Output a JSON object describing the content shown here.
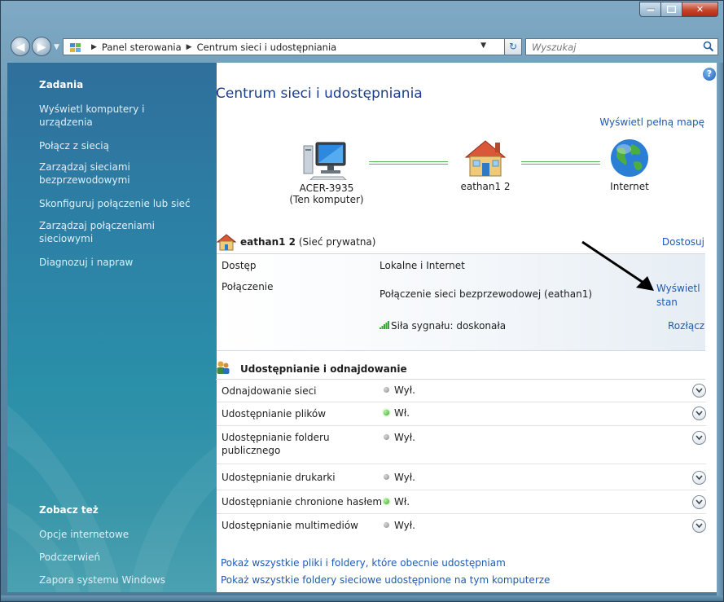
{
  "address": {
    "crumbs": [
      "Panel sterowania",
      "Centrum sieci i udostępniania"
    ],
    "search_placeholder": "Wyszukaj"
  },
  "sidebar": {
    "tasks_header": "Zadania",
    "tasks": [
      "Wyświetl komputery i urządzenia",
      "Połącz z siecią",
      "Zarządzaj sieciami bezprzewodowymi",
      "Skonfiguruj połączenie lub sieć",
      "Zarządzaj połączeniami sieciowymi",
      "Diagnozuj i napraw"
    ],
    "see_also_header": "Zobacz też",
    "see_also": [
      "Opcje internetowe",
      "Podczerwień",
      "Zapora systemu Windows"
    ]
  },
  "main": {
    "title": "Centrum sieci i udostępniania",
    "full_map_link": "Wyświetl pełną mapę",
    "nodes": [
      {
        "line1": "ACER-3935",
        "line2": "(Ten komputer)"
      },
      {
        "line1": "eathan1  2",
        "line2": ""
      },
      {
        "line1": "Internet",
        "line2": ""
      }
    ],
    "network": {
      "name": "eathan1  2",
      "type": "(Sieć prywatna)",
      "customize": "Dostosuj",
      "access_label": "Dostęp",
      "access_value": "Lokalne i Internet",
      "connection_label": "Połączenie",
      "connection_value": "Połączenie sieci bezprzewodowej (eathan1)",
      "view_status": "Wyświetl stan",
      "signal": "Siła sygnału: doskonała",
      "disconnect": "Rozłącz"
    },
    "sharing": {
      "header": "Udostępnianie i odnajdowanie",
      "rows": [
        {
          "label": "Odnajdowanie sieci",
          "status": "Wył.",
          "on": false
        },
        {
          "label": "Udostępnianie plików",
          "status": "Wł.",
          "on": true
        },
        {
          "label": "Udostępnianie folderu publicznego",
          "status": "Wył.",
          "on": false
        },
        {
          "label": "Udostępnianie drukarki",
          "status": "Wył.",
          "on": false
        },
        {
          "label": "Udostępnianie chronione hasłem",
          "status": "Wł.",
          "on": true
        },
        {
          "label": "Udostępnianie multimediów",
          "status": "Wył.",
          "on": false
        }
      ]
    },
    "bottom_links": [
      "Pokaż wszystkie pliki i foldery, które obecnie udostępniam",
      "Pokaż wszystkie foldery sieciowe udostępnione na tym komputerze"
    ]
  },
  "colors": {
    "link": "#1f5ab5",
    "title": "#1a3e8c",
    "sidebar": "#2c82a6"
  }
}
